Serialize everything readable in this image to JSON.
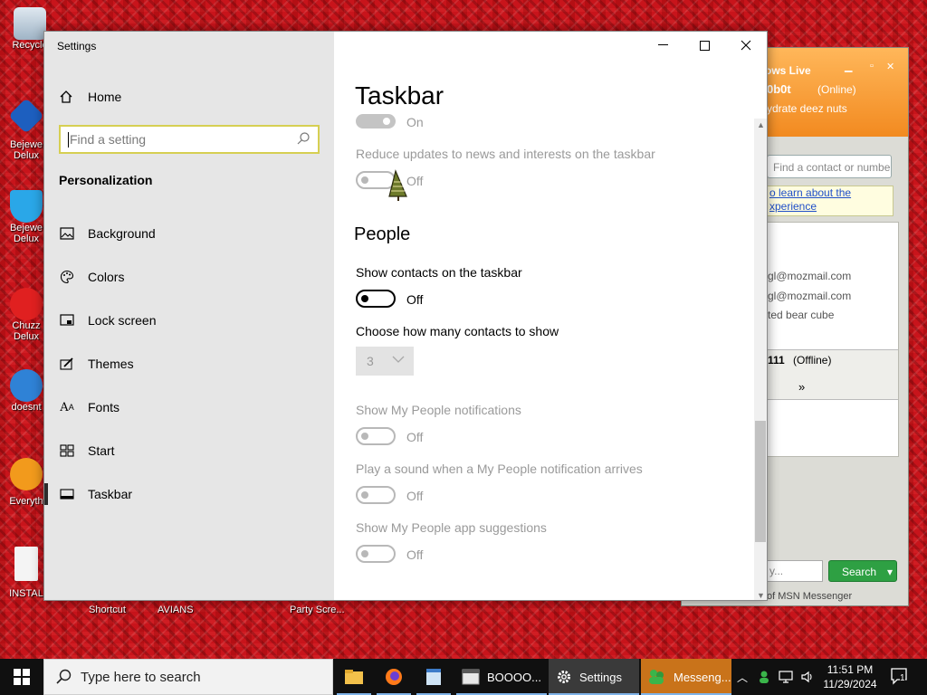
{
  "desktop": {
    "icons": [
      {
        "label": "Recycle"
      },
      {
        "label": "Bejewe Delux"
      },
      {
        "label": "Bejewe Delux"
      },
      {
        "label": "Chuzz Delux"
      },
      {
        "label": "doesnt"
      },
      {
        "label": "Everyth"
      },
      {
        "label": "INSTAL"
      }
    ],
    "bottom_labels": [
      "Shortcut",
      "AVIANS",
      "Party Scre..."
    ]
  },
  "messenger": {
    "title": "ows Live",
    "username": "0b0t",
    "status": "(Online)",
    "personal_message": "ydrate deez nuts",
    "search_placeholder": "Find a contact or numbe",
    "notice_line1": "o learn about the",
    "notice_line2": "xperience",
    "contacts": [
      "gl@mozmail.com",
      "gl@mozmail.com",
      "ted bear cube"
    ],
    "group_name": "111",
    "group_status": "(Offline)",
    "more": "»",
    "input_value": "y...",
    "search_button": "Search",
    "footer": "of MSN Messenger"
  },
  "settings": {
    "window_title": "Settings",
    "home_label": "Home",
    "search_placeholder": "Find a setting",
    "section_title": "Personalization",
    "nav": [
      {
        "label": "Background",
        "icon": "picture-icon"
      },
      {
        "label": "Colors",
        "icon": "palette-icon"
      },
      {
        "label": "Lock screen",
        "icon": "lock-screen-icon"
      },
      {
        "label": "Themes",
        "icon": "brush-icon"
      },
      {
        "label": "Fonts",
        "icon": "font-icon"
      },
      {
        "label": "Start",
        "icon": "start-grid-icon"
      },
      {
        "label": "Taskbar",
        "icon": "taskbar-icon"
      }
    ],
    "active_nav": "Taskbar",
    "page_title": "Taskbar",
    "toggle_top_state": "On",
    "reduce_updates_label": "Reduce updates to news and interests on the taskbar",
    "reduce_updates_state": "Off",
    "people_heading": "People",
    "show_contacts_label": "Show contacts on the taskbar",
    "show_contacts_state": "Off",
    "contacts_count_label": "Choose how many contacts to show",
    "contacts_count_value": "3",
    "people_notifications_label": "Show My People notifications",
    "people_notifications_state": "Off",
    "people_sound_label": "Play a sound when a My People notification arrives",
    "people_sound_state": "Off",
    "people_suggestions_label": "Show My People app suggestions",
    "people_suggestions_state": "Off"
  },
  "taskbar": {
    "search_placeholder": "Type here to search",
    "apps": [
      {
        "label": "",
        "icon": "file-explorer-icon"
      },
      {
        "label": "",
        "icon": "firefox-icon"
      },
      {
        "label": "",
        "icon": "notepad-icon"
      },
      {
        "label": "BOOOO...",
        "icon": "window-icon"
      },
      {
        "label": "Settings",
        "icon": "gear-icon"
      },
      {
        "label": "Messeng...",
        "icon": "messenger-icon"
      }
    ],
    "time": "11:51 PM",
    "date": "11/29/2024",
    "notification_count": "1"
  },
  "colors": {
    "desktop_red": "#c8141b",
    "msn_orange": "#f28a20",
    "search_green": "#2ea043",
    "focus_yellow": "#d6cf52"
  }
}
